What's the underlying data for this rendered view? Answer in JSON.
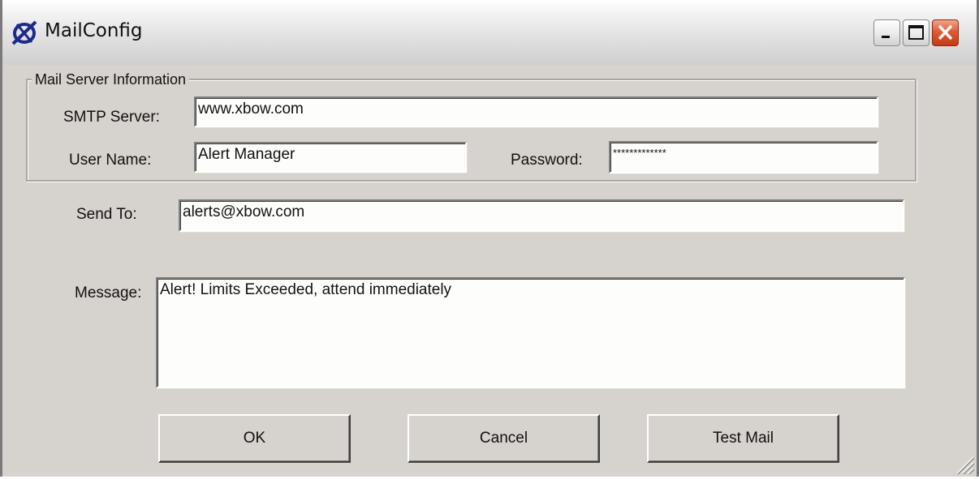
{
  "window": {
    "title": "MailConfig",
    "icon": "mail-config-app-icon",
    "controls": {
      "minimize_icon": "minimize-icon",
      "maximize_icon": "maximize-icon",
      "close_icon": "close-icon"
    }
  },
  "group": {
    "legend": "Mail Server Information",
    "smtp_label": "SMTP Server:",
    "smtp_value": "www.xbow.com",
    "username_label": "User Name:",
    "username_value": "Alert Manager",
    "password_label": "Password:",
    "password_value": "*************"
  },
  "send_to": {
    "label": "Send To:",
    "value": "alerts@xbow.com"
  },
  "message": {
    "label": "Message:",
    "value": "Alert! Limits Exceeded, attend immediately"
  },
  "buttons": {
    "ok": "OK",
    "cancel": "Cancel",
    "test_mail": "Test Mail"
  },
  "colors": {
    "face": "#d6d3ce",
    "field_bg": "#fdfdfb",
    "close_red": "#e05a34",
    "icon_blue": "#1c2a8c"
  }
}
